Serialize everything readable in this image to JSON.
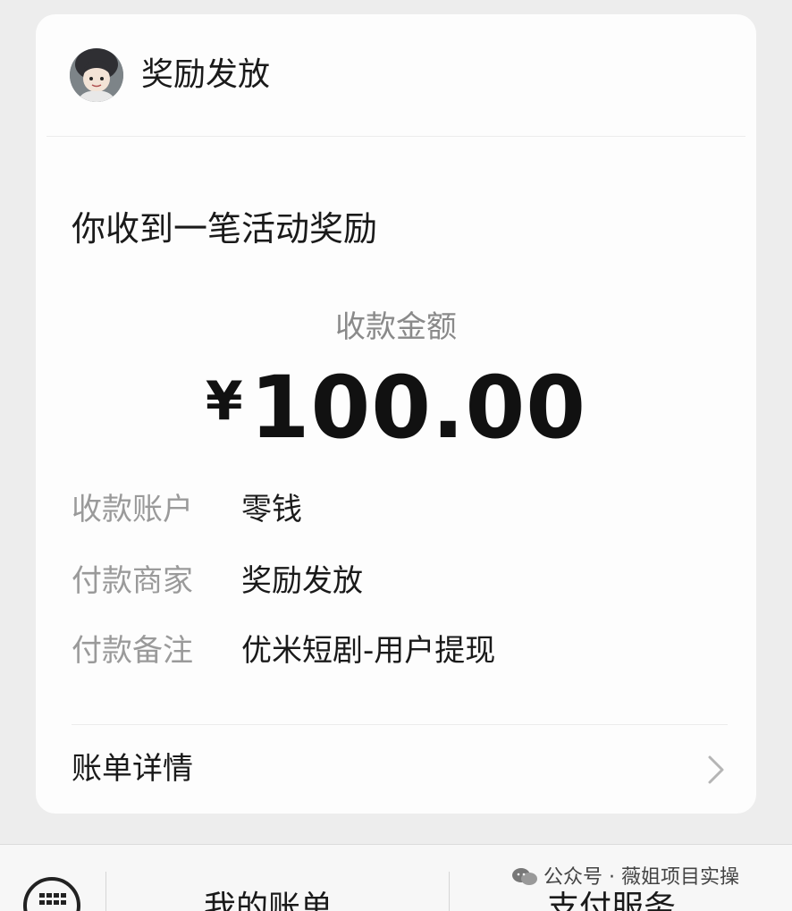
{
  "sender": {
    "name": "奖励发放"
  },
  "message": {
    "title": "你收到一笔活动奖励"
  },
  "amount": {
    "label": "收款金额",
    "currency": "¥",
    "value": "100.00"
  },
  "details": [
    {
      "label": "收款账户",
      "value": "零钱"
    },
    {
      "label": "付款商家",
      "value": "奖励发放"
    },
    {
      "label": "付款备注",
      "value": "优米短剧-用户提现"
    }
  ],
  "bill": {
    "label": "账单详情",
    "icon": "chevron-right-icon"
  },
  "bottom_bar": {
    "keyboard_icon": "keyboard-icon",
    "menu_left": "我的账单",
    "menu_right": "支付服务"
  },
  "watermark": {
    "icon": "wechat-icon",
    "text": "公众号 · 薇姐项目实操"
  },
  "colors": {
    "background": "#ededed",
    "card": "#fdfdfd",
    "label_gray": "#9a9a9a",
    "text_dark": "#1a1a1a"
  }
}
